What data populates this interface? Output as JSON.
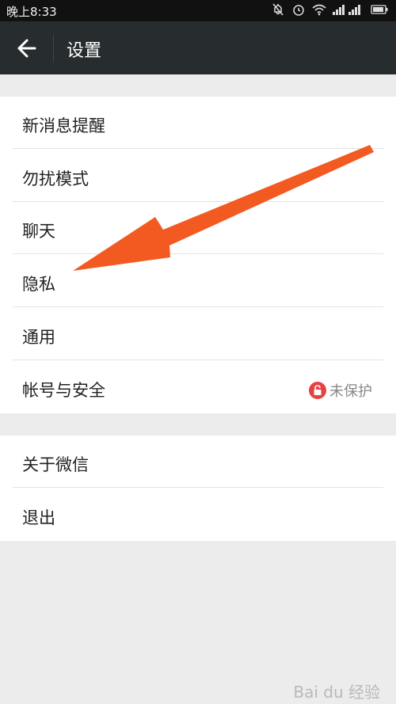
{
  "status_bar": {
    "time": "晚上8:33"
  },
  "header": {
    "title": "设置"
  },
  "menu": {
    "group1": [
      {
        "label": "新消息提醒"
      },
      {
        "label": "勿扰模式"
      },
      {
        "label": "聊天"
      },
      {
        "label": "隐私"
      },
      {
        "label": "通用"
      },
      {
        "label": "帐号与安全",
        "badge": "未保护"
      }
    ],
    "group2": [
      {
        "label": "关于微信"
      },
      {
        "label": "退出"
      }
    ]
  },
  "watermark": "Bai du 经验",
  "colors": {
    "appbar": "#272d2f",
    "badge_red": "#e64340",
    "arrow": "#f35a21"
  }
}
